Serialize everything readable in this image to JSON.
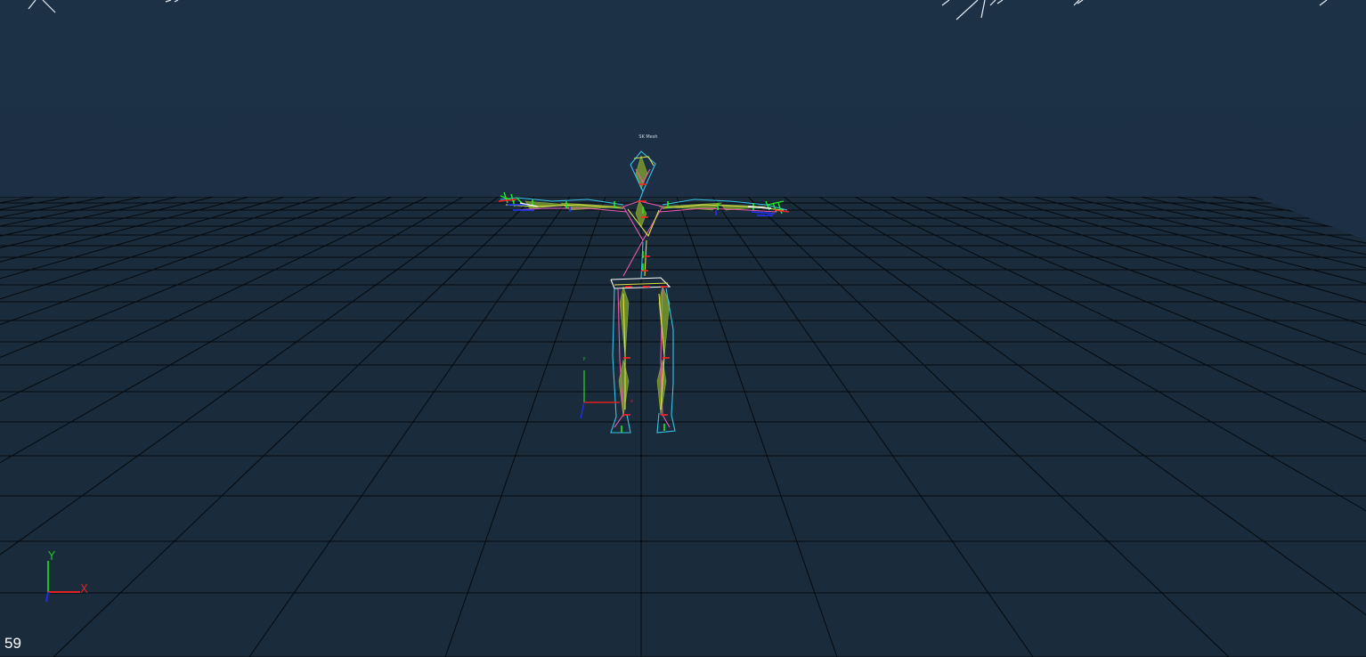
{
  "viewport": {
    "background_color": "#1b2f44",
    "floor_color": "#1a2b3b",
    "grid_line_color": "#05090d",
    "skeleton_bone_colors": [
      "#38c4e8",
      "#e0e04a",
      "#e85ab0",
      "#ffffff"
    ],
    "joint_marker_colors": [
      "#ff2222",
      "#22ee22",
      "#2233ff"
    ],
    "mesh_fill_color": "#6f8f2e"
  },
  "gizmo": {
    "x_label": "X",
    "y_label": "Y",
    "x_color": "#e02020",
    "y_color": "#20c020",
    "z_color": "#2030e0"
  },
  "pivot_gizmo": {
    "x_label": "x",
    "y_label": "y"
  },
  "skeleton": {
    "name_label": "SK Mesh"
  },
  "status": {
    "fps": "59"
  }
}
